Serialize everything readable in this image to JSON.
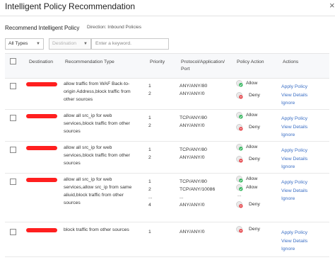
{
  "header": {
    "title": "Intelligent Policy Recommendation",
    "close_glyph": "×"
  },
  "toolbar": {
    "section_title": "Recommend Intelligent Policy",
    "direction": "Direction: Inbound Policies",
    "type_select": "All Types",
    "destination_select": "Destination",
    "search_placeholder": "Enter a keyword."
  },
  "columns": {
    "destination": "Destination",
    "type": "Recommendation Type",
    "priority": "Priority",
    "protocol_line1": "Protocol/Application/",
    "protocol_line2": "Port",
    "action": "Policy Action",
    "actions": "Actions"
  },
  "links": {
    "apply": "Apply Policy",
    "view": "View Details",
    "ignore": "Ignore"
  },
  "colors": {
    "link": "#3b6fc5",
    "allow": "#2fb45a",
    "deny": "#e5484d",
    "redaction": "#ff1f1f"
  },
  "rows": [
    {
      "type": [
        "allow traffic from WAF Back-to-",
        "origin Address,block traffic from",
        "other sources"
      ],
      "priority": [
        "1",
        "2"
      ],
      "protocol": [
        "ANY/ANY/80",
        "ANY/ANY/0"
      ],
      "actions": [
        "Allow",
        "Deny"
      ]
    },
    {
      "type": [
        "allow all src_ip for web",
        "services,block traffic from other",
        "sources"
      ],
      "priority": [
        "1",
        "2"
      ],
      "protocol": [
        "TCP/ANY/80",
        "ANY/ANY/0"
      ],
      "actions": [
        "Allow",
        "Deny"
      ]
    },
    {
      "type": [
        "allow all src_ip for web",
        "services,block traffic from other",
        "sources"
      ],
      "priority": [
        "1",
        "2"
      ],
      "protocol": [
        "TCP/ANY/80",
        "ANY/ANY/0"
      ],
      "actions": [
        "Allow",
        "Deny"
      ]
    },
    {
      "type": [
        "allow all src_ip for web",
        "services,allow src_ip from same",
        "aliuid,block traffic from other",
        "sources"
      ],
      "priority": [
        "1",
        "2",
        "...",
        "4"
      ],
      "protocol": [
        "TCP/ANY/80",
        "TCP/ANY/10086",
        "...",
        "ANY/ANY/0"
      ],
      "actions": [
        "Allow",
        "Allow",
        "...",
        "Deny"
      ]
    },
    {
      "type": [
        "block traffic from other sources"
      ],
      "priority": [
        "1"
      ],
      "protocol": [
        "ANY/ANY/0"
      ],
      "actions": [
        "Deny"
      ]
    }
  ]
}
